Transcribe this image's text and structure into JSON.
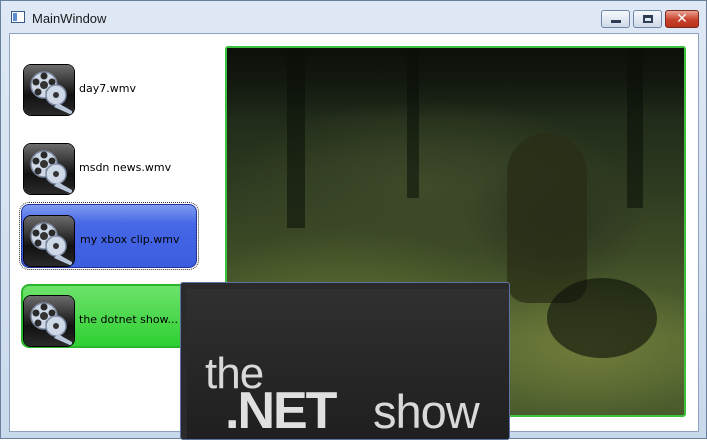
{
  "window": {
    "title": "MainWindow",
    "close_glyph": "✕"
  },
  "playlist": {
    "items": [
      {
        "label": "day7.wmv",
        "icon": "film-reel-icon",
        "state": "normal"
      },
      {
        "label": "msdn news.wmv",
        "icon": "film-reel-icon",
        "state": "normal"
      },
      {
        "label": "my xbox clip.wmv",
        "icon": "film-reel-icon",
        "state": "selected"
      },
      {
        "label": "the dotnet show...",
        "icon": "film-reel-icon",
        "state": "hover"
      }
    ]
  },
  "preview": {
    "line1": "the",
    "line2": ".NET",
    "line3": "show"
  },
  "colors": {
    "selected": "#3b5edf",
    "hover": "#2ecf32",
    "video_border": "#3cc13c"
  }
}
